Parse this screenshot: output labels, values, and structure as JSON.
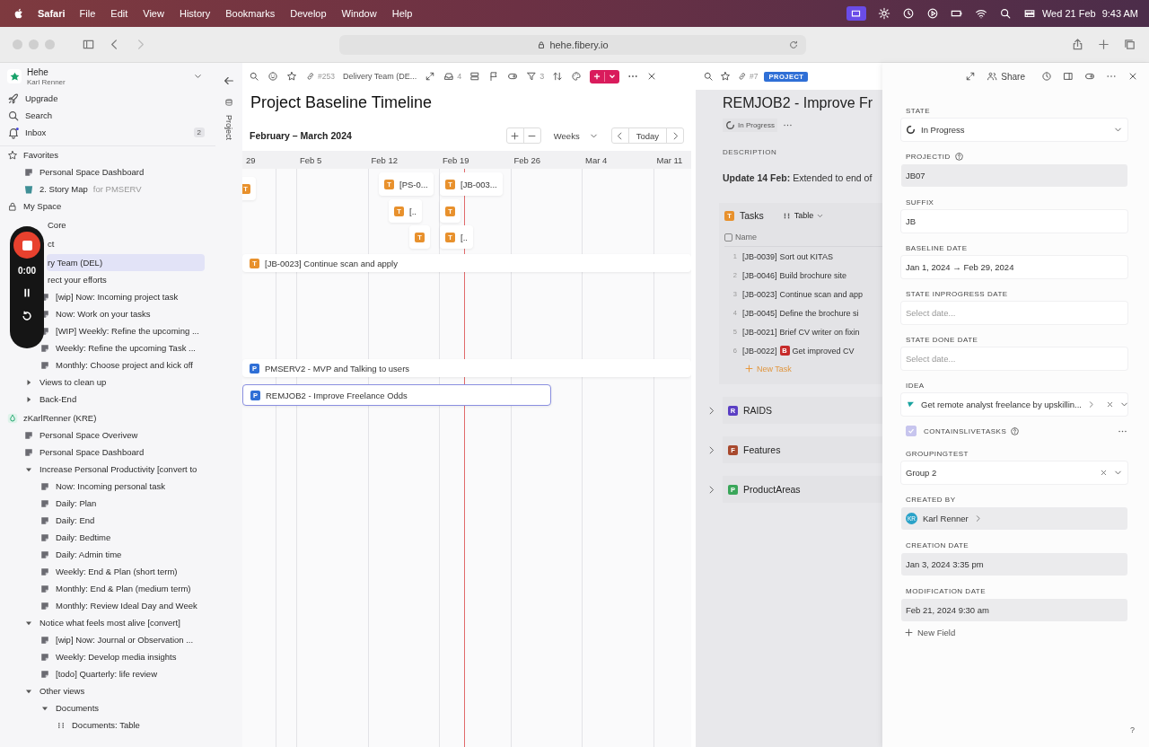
{
  "menubar": {
    "app": "Safari",
    "menus": [
      "File",
      "Edit",
      "View",
      "History",
      "Bookmarks",
      "Develop",
      "Window",
      "Help"
    ],
    "date": "Wed 21 Feb",
    "time": "9:43 AM"
  },
  "browser": {
    "url": "hehe.fibery.io"
  },
  "workspace": {
    "name": "Hehe",
    "user": "Karl Renner"
  },
  "nav": [
    {
      "label": "Upgrade",
      "kind": "upgrade"
    },
    {
      "label": "Search",
      "kind": "search"
    },
    {
      "label": "Inbox",
      "kind": "inbox",
      "count": "2"
    }
  ],
  "tree": [
    {
      "label": "Favorites",
      "kind": "section",
      "selected": false,
      "children": [
        {
          "label": "Personal Space Dashboard",
          "kind": "doc",
          "selected": false
        },
        {
          "label": "2. Story Map",
          "suffix": "for PMSERV",
          "kind": "board",
          "selected": false
        }
      ]
    },
    {
      "label": "My Space",
      "kind": "lock",
      "selected": false
    },
    {
      "label": "Core",
      "kind": "space",
      "covered": true,
      "selected": false
    },
    {
      "label": "ct",
      "kind": "space",
      "covered": true,
      "selected": false
    },
    {
      "label": "ry Team (DEL)",
      "kind": "space",
      "covered": true,
      "selected": true,
      "children": [
        {
          "label": "rect your efforts",
          "kind": "folder",
          "covered": true,
          "selected": false,
          "children": [
            {
              "label": "[wip] Now: Incoming project task",
              "kind": "doc",
              "selected": false
            },
            {
              "label": "Now: Work on your tasks",
              "kind": "doc",
              "selected": false
            },
            {
              "label": "[WIP] Weekly: Refine the upcoming ...",
              "kind": "doc",
              "selected": false
            },
            {
              "label": "Weekly: Refine the upcoming Task ...",
              "kind": "doc",
              "selected": false
            },
            {
              "label": "Monthly: Choose project and kick off",
              "kind": "doc",
              "selected": false
            }
          ]
        },
        {
          "label": "Views to clean up",
          "kind": "folder",
          "expanded": false,
          "selected": false
        },
        {
          "label": "Back-End",
          "kind": "folder",
          "expanded": false,
          "selected": false
        }
      ]
    },
    {
      "label": "zKarlRenner (KRE)",
      "kind": "space",
      "selected": false,
      "children": [
        {
          "label": "Personal Space Overivew",
          "kind": "doc",
          "selected": false
        },
        {
          "label": "Personal Space Dashboard",
          "kind": "doc",
          "selected": false
        },
        {
          "label": "Increase Personal Productivity [convert to",
          "kind": "folder",
          "expanded": true,
          "selected": false,
          "children": [
            {
              "label": "Now: Incoming personal task",
              "kind": "doc",
              "selected": false
            },
            {
              "label": "Daily: Plan",
              "kind": "doc",
              "selected": false
            },
            {
              "label": "Daily: End",
              "kind": "doc",
              "selected": false
            },
            {
              "label": "Daily: Bedtime",
              "kind": "doc",
              "selected": false
            },
            {
              "label": "Daily: Admin time",
              "kind": "doc",
              "selected": false
            },
            {
              "label": "Weekly: End & Plan (short term)",
              "kind": "doc",
              "selected": false
            },
            {
              "label": "Monthly: End & Plan (medium term)",
              "kind": "doc",
              "selected": false
            },
            {
              "label": "Monthly: Review Ideal Day and Week",
              "kind": "doc",
              "selected": false
            }
          ]
        },
        {
          "label": "Notice what feels most alive [convert]",
          "kind": "folder",
          "expanded": true,
          "selected": false,
          "children": [
            {
              "label": "[wip] Now: Journal or Observation ...",
              "kind": "doc",
              "selected": false
            },
            {
              "label": "Weekly: Develop media insights",
              "kind": "doc",
              "selected": false
            },
            {
              "label": "[todo] Quarterly: life review",
              "kind": "doc",
              "selected": false
            }
          ]
        },
        {
          "label": "Other views",
          "kind": "folder",
          "expanded": true,
          "selected": false,
          "children": [
            {
              "label": "Documents",
              "kind": "folder",
              "expanded": true,
              "selected": false,
              "children": [
                {
                  "label": "Documents: Table",
                  "kind": "table",
                  "selected": false
                }
              ]
            }
          ]
        }
      ]
    }
  ],
  "recorder": {
    "time": "0:00"
  },
  "strip": {
    "label": "Project"
  },
  "view": {
    "ref": "#253",
    "breadcrumb": "Delivery Team (DE...",
    "inbox_count": "4",
    "filter_count": "3",
    "title": "Project Baseline Timeline",
    "range": "February – March 2024",
    "scale": "Weeks",
    "today": "Today"
  },
  "weeks": [
    "29",
    "Feb 5",
    "Feb 12",
    "Feb 19",
    "Feb 26",
    "Mar 4",
    "Mar 11"
  ],
  "bars": [
    {
      "badge": "T",
      "color": "#e8912d",
      "selected": false
    },
    {
      "badge": "T",
      "label": "[PS-0...",
      "color": "#e8912d",
      "selected": false
    },
    {
      "badge": "T",
      "label": "[JB-003...",
      "color": "#e8912d",
      "selected": false
    },
    {
      "badge": "T",
      "label": "[..",
      "color": "#e8912d",
      "selected": false
    },
    {
      "badge": "T",
      "color": "#e8912d",
      "selected": false
    },
    {
      "badge": "T",
      "color": "#e8912d",
      "selected": false
    },
    {
      "badge": "T",
      "label": "[..",
      "color": "#e8912d",
      "selected": false
    },
    {
      "badge": "T",
      "label": "[JB-0023] Continue scan and apply",
      "color": "#e8912d",
      "selected": false
    },
    {
      "badge": "P",
      "label": "PMSERV2 - MVP and Talking to users",
      "color": "#2f6fd6",
      "selected": false
    },
    {
      "badge": "P",
      "label": "REMJOB2 - Improve Freelance Odds",
      "color": "#2f6fd6",
      "selected": true
    }
  ],
  "detail": {
    "ref": "#7",
    "type": "PROJECT",
    "title": "REMJOB2 - Improve Fr",
    "state": "In Progress",
    "description_label": "DESCRIPTION",
    "description": "**Update 14 Feb:** Extended to end of",
    "tasks": {
      "badge": "T",
      "all_checked": false,
      "title": "Tasks",
      "view": "Table",
      "column": "Name",
      "new": "New Task",
      "rows": [
        {
          "num": "1",
          "id": "[JB-0039]",
          "name": "Sort out KITAS"
        },
        {
          "num": "2",
          "id": "[JB-0046]",
          "name": "Build brochure site"
        },
        {
          "num": "3",
          "id": "[JB-0023]",
          "name": "Continue scan and app"
        },
        {
          "num": "4",
          "id": "[JB-0045]",
          "name": "Define the brochure si"
        },
        {
          "num": "5",
          "id": "[JB-0021]",
          "name": "Brief CV writer on fixin"
        },
        {
          "num": "6",
          "id": "[JB-0022]",
          "badge": "B",
          "name": "Get improved CV"
        }
      ]
    },
    "sections": [
      {
        "badge": "R",
        "label": "RAIDS",
        "color": "#5b3fc4",
        "expanded": false
      },
      {
        "badge": "F",
        "label": "Features",
        "color": "#a8492e",
        "expanded": false
      },
      {
        "badge": "P",
        "label": "ProductAreas",
        "color": "#3aa65a",
        "expanded": false
      }
    ]
  },
  "properties": {
    "share": "Share",
    "new_field": "New Field",
    "help_button": "?",
    "fields": [
      {
        "label": "STATE",
        "kind": "state",
        "value": "In Progress",
        "readonly": false
      },
      {
        "label": "PROJECTID",
        "kind": "text",
        "value": "JB07",
        "help": true,
        "readonly": true
      },
      {
        "label": "SUFFIX",
        "kind": "text",
        "value": "JB",
        "readonly": false
      },
      {
        "label": "BASELINE DATE",
        "kind": "text",
        "value": "Jan 1, 2024 → Feb 29, 2024",
        "readonly": false
      },
      {
        "label": "STATE INPROGRESS DATE",
        "kind": "date",
        "placeholder": "Select date...",
        "readonly": false
      },
      {
        "label": "STATE DONE DATE",
        "kind": "date",
        "placeholder": "Select date...",
        "readonly": false
      },
      {
        "label": "IDEA",
        "kind": "relation",
        "value": "Get remote analyst freelance by upskillin...",
        "clearable": true,
        "readonly": false
      },
      {
        "label": "CONTAINSLIVETASKS",
        "kind": "checkbox",
        "checked": true,
        "help": true
      },
      {
        "label": "GROUPINGTEST",
        "kind": "select",
        "value": "Group 2",
        "clearable": true,
        "readonly": false
      },
      {
        "label": "CREATED BY",
        "kind": "user",
        "initials": "KR",
        "value": "Karl Renner",
        "readonly": true
      },
      {
        "label": "CREATION DATE",
        "kind": "text",
        "value": "Jan 3, 2024 3:35 pm",
        "readonly": true
      },
      {
        "label": "MODIFICATION DATE",
        "kind": "text",
        "value": "Feb 21, 2024 9:30 am",
        "readonly": true
      }
    ]
  }
}
